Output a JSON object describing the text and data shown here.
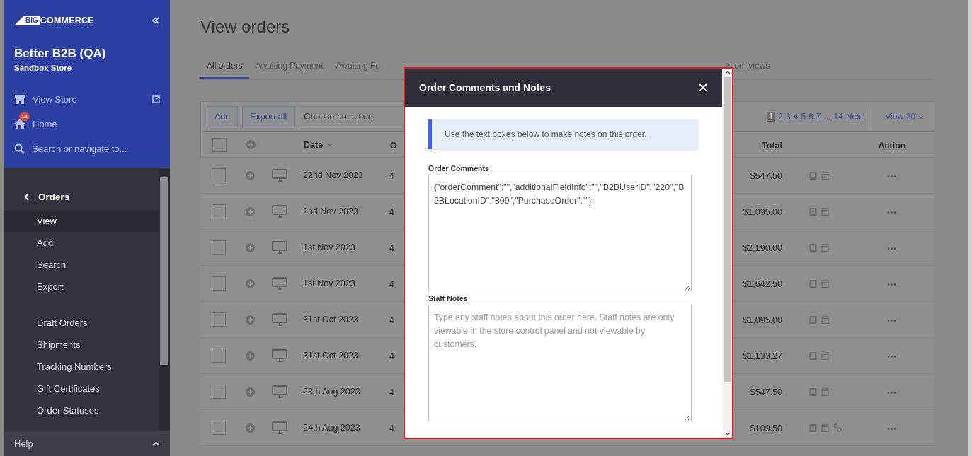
{
  "sidebar": {
    "logo": "COMMERCE",
    "logo_mark": "BIG",
    "store_name": "Better B2B (QA)",
    "store_type": "Sandbox Store",
    "links": [
      {
        "kind": "store",
        "label": "View Store"
      },
      {
        "kind": "home",
        "label": "Home",
        "badge": "16"
      },
      {
        "kind": "search",
        "label": "Search or navigate to..."
      }
    ],
    "section": "Orders",
    "groups": [
      {
        "items": [
          {
            "label": "View",
            "selected": true
          },
          {
            "label": "Add",
            "selected": false
          },
          {
            "label": "Search",
            "selected": false
          },
          {
            "label": "Export",
            "selected": false
          }
        ]
      },
      {
        "items": [
          {
            "label": "Draft Orders",
            "selected": false
          },
          {
            "label": "Shipments",
            "selected": false
          },
          {
            "label": "Tracking Numbers",
            "selected": false
          },
          {
            "label": "Gift Certificates",
            "selected": false
          },
          {
            "label": "Order Statuses",
            "selected": false
          }
        ]
      }
    ],
    "footer": "Help"
  },
  "page": {
    "title": "View orders",
    "tabs": [
      {
        "label": "All orders",
        "selected": true
      },
      {
        "label": "Awaiting Payment",
        "selected": false
      },
      {
        "label": "Awaiting Fu",
        "selected": false
      }
    ],
    "tab_tail": "stom views",
    "toolbar": {
      "buttons": [
        "Add",
        "Export all"
      ],
      "action_select": "Choose an action",
      "pages": [
        {
          "label": "1",
          "selected": true
        },
        {
          "label": "2",
          "selected": false
        },
        {
          "label": "3",
          "selected": false
        },
        {
          "label": "4",
          "selected": false
        },
        {
          "label": "5",
          "selected": false
        },
        {
          "label": "6",
          "selected": false
        },
        {
          "label": "7",
          "selected": false
        }
      ],
      "ellipsis": "...",
      "last_page": "14",
      "next": "Next",
      "view": "View 20"
    },
    "table": {
      "columns": [
        "Date",
        "O",
        "Total",
        "Action"
      ],
      "select_all_checked": false,
      "rows": [
        {
          "checked": false,
          "date": "22nd Nov 2023",
          "order": "4",
          "total": "$547.50",
          "link": false
        },
        {
          "checked": false,
          "date": "2nd Nov 2023",
          "order": "4",
          "total": "$1,095.00",
          "link": false
        },
        {
          "checked": false,
          "date": "1st Nov 2023",
          "order": "4",
          "total": "$2,190.00",
          "link": false
        },
        {
          "checked": false,
          "date": "1st Nov 2023",
          "order": "4",
          "total": "$1,642.50",
          "link": false
        },
        {
          "checked": false,
          "date": "31st Oct 2023",
          "order": "4",
          "total": "$1,095.00",
          "link": false
        },
        {
          "checked": false,
          "date": "31st Oct 2023",
          "order": "4",
          "total": "$1,133.27",
          "link": false
        },
        {
          "checked": false,
          "date": "28th Aug 2023",
          "order": "4",
          "total": "$547.50",
          "link": false
        },
        {
          "checked": false,
          "date": "24th Aug 2023",
          "order": "4",
          "total": "$109.50",
          "link": true
        }
      ],
      "action": "•••"
    }
  },
  "modal": {
    "title": "Order Comments and Notes",
    "close": "×",
    "info": "Use the text boxes below to make notes on this order.",
    "fields": [
      {
        "kind": "value",
        "label": "Order Comments",
        "value": "{\"orderComment\":\"\",\"additionalFieldInfo\":\"\",\"B2BUserID\":\"220\",\"B2BLocationID\":\"809\",\"PurchaseOrder\":\"\"}"
      },
      {
        "kind": "placeholder",
        "label": "Staff Notes",
        "placeholder": "Type any staff notes about this order here. Staff notes are only viewable in the store control panel and not viewable by customers."
      }
    ]
  }
}
